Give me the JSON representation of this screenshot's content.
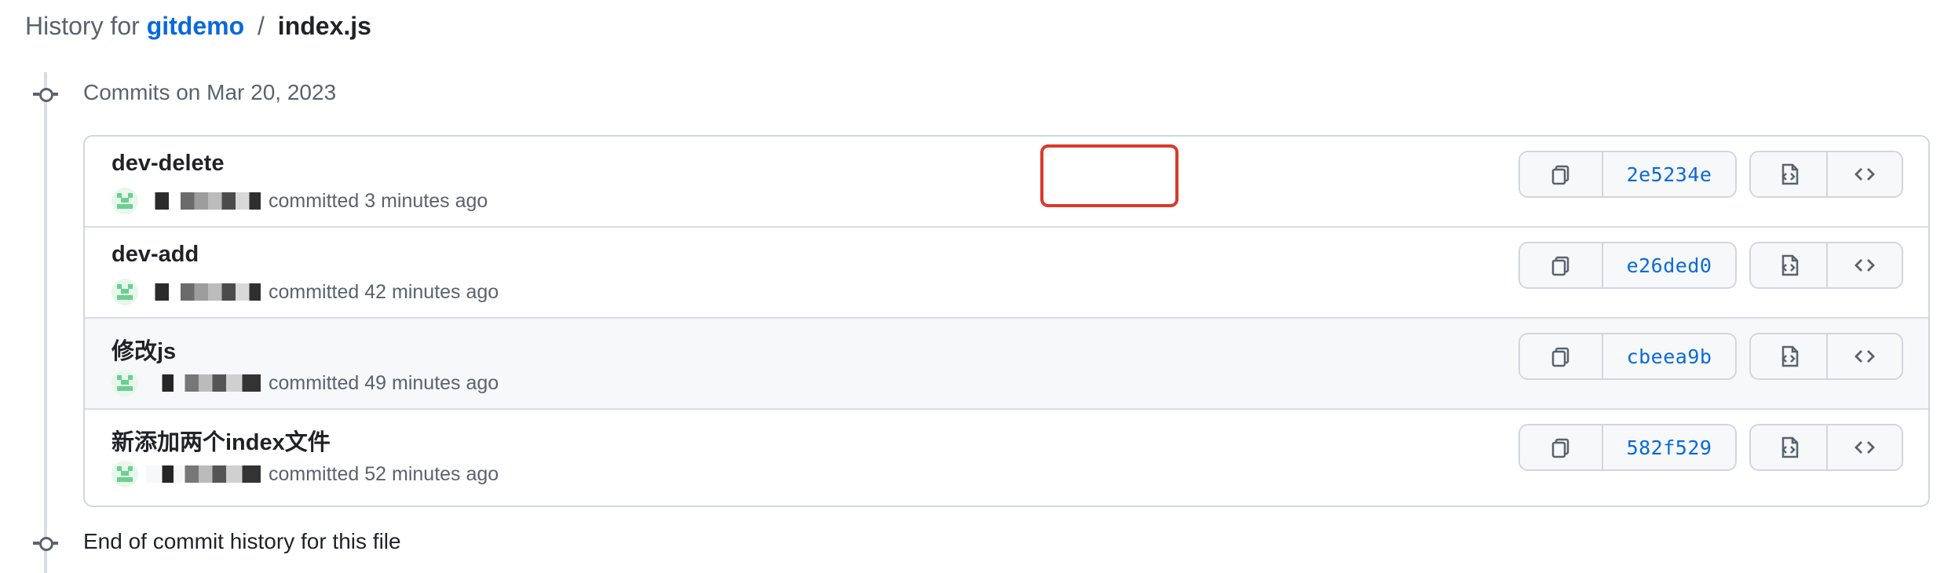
{
  "header": {
    "prefix": "History for",
    "repo": "gitdemo",
    "separator": "/",
    "file": "index.js"
  },
  "timeline": {
    "group_label": "Commits on Mar 20, 2023",
    "end_label": "End of commit history for this file"
  },
  "commits": [
    {
      "title": "dev-delete",
      "meta": "committed 3 minutes ago",
      "sha": "2e5234e",
      "highlighted": true
    },
    {
      "title": "dev-add",
      "meta": "committed 42 minutes ago",
      "sha": "e26ded0",
      "highlighted": false
    },
    {
      "title": "修改js",
      "meta": "committed 49 minutes ago",
      "sha": "cbeea9b",
      "highlighted": false
    },
    {
      "title": "新添加两个index文件",
      "meta": "committed 52 minutes ago",
      "sha": "582f529",
      "highlighted": false
    }
  ],
  "icons": {
    "copy": "copy-icon",
    "browse": "file-code-icon",
    "code": "code-icon"
  },
  "colors": {
    "link": "#0969da",
    "highlight": "#d93a2b",
    "border": "#d0d7de"
  }
}
